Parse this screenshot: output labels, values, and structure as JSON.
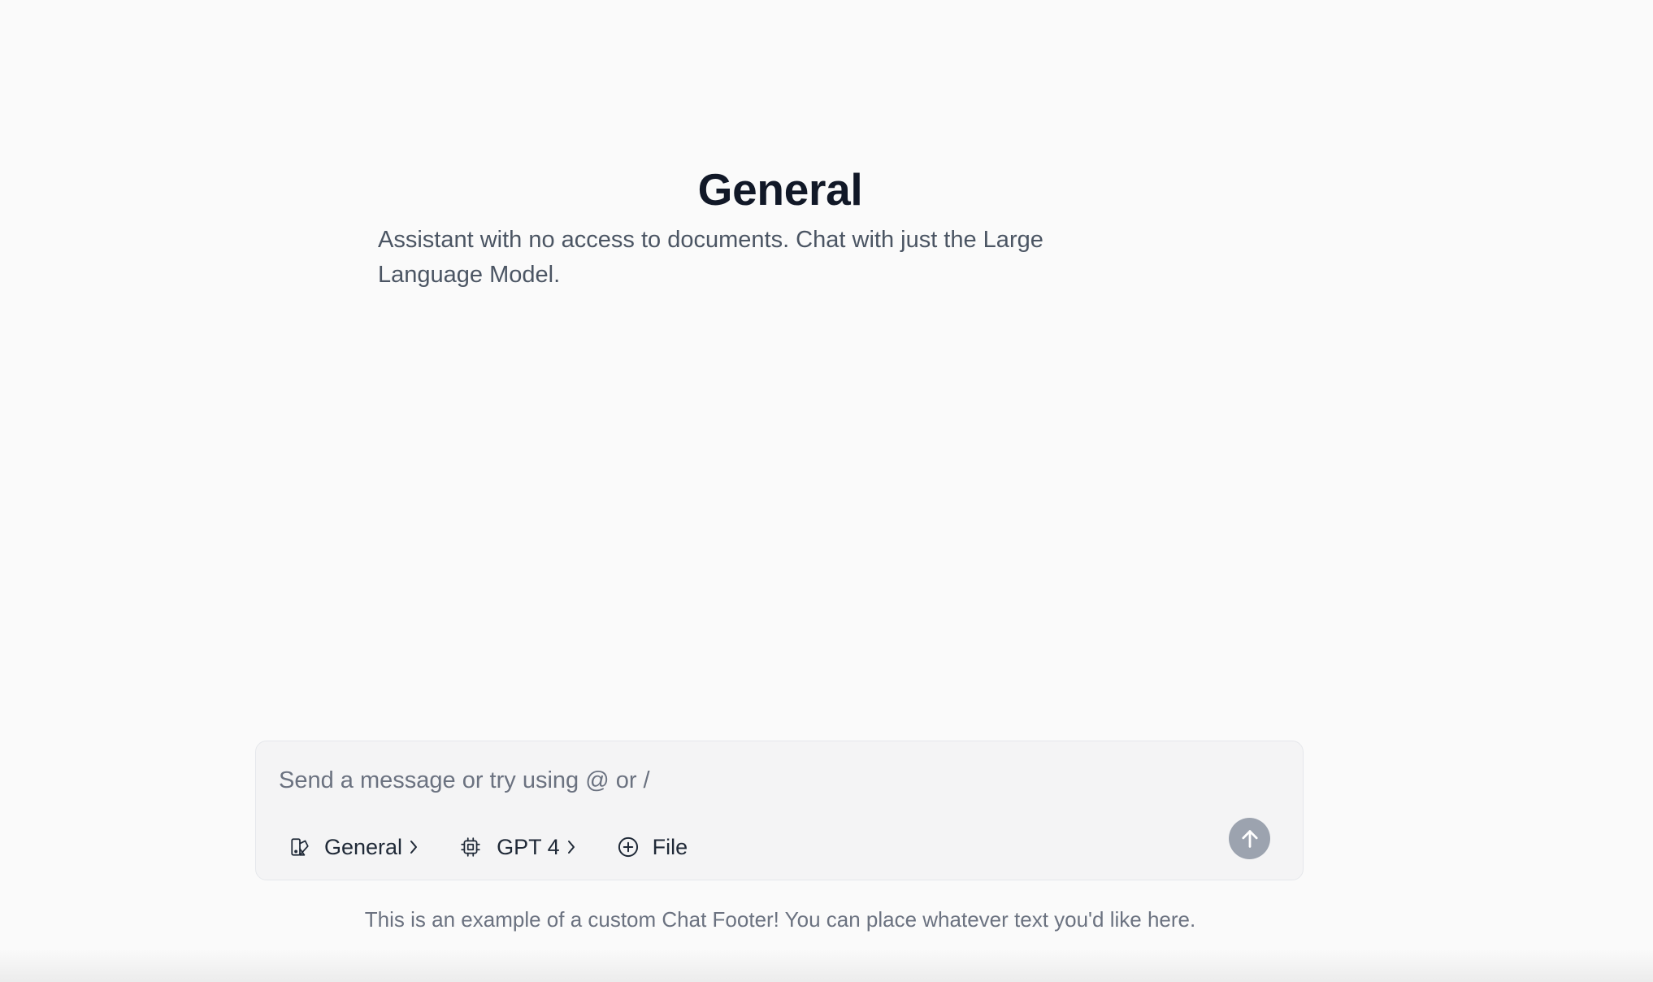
{
  "assistant": {
    "title": "General",
    "description": "Assistant with no access to documents. Chat with just the Large Language Model."
  },
  "composer": {
    "placeholder": "Send a message or try using @ or /",
    "assistant_selector": {
      "label": "General",
      "icon": "assistant-icon"
    },
    "model_selector": {
      "label": "GPT 4",
      "icon": "cpu-chip-icon"
    },
    "file_button": {
      "label": "File",
      "icon": "plus-circle-icon"
    },
    "send_button": {
      "icon": "arrow-up-icon"
    }
  },
  "footer": {
    "text": "This is an example of a custom Chat Footer! You can place whatever text you'd like here."
  },
  "colors": {
    "background": "#fafafa",
    "title": "#111827",
    "body_text": "#4b5563",
    "send_button": "#9ca3af"
  }
}
